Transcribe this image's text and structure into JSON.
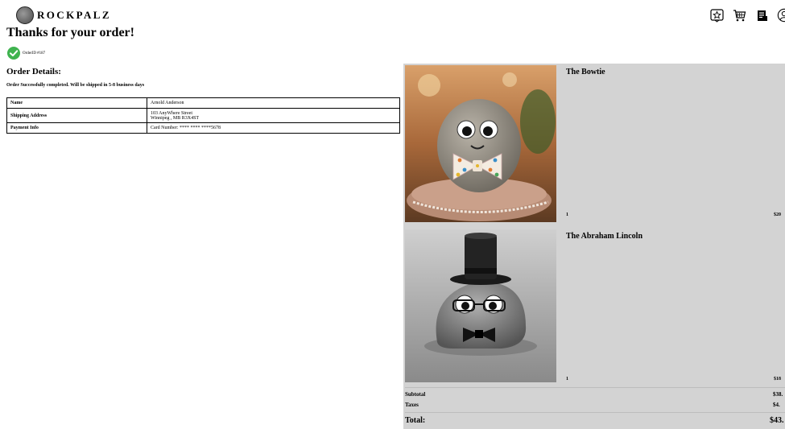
{
  "header": {
    "brand": "ROCKPALZ",
    "icons": [
      "favorites-icon",
      "cart-icon",
      "orders-icon",
      "account-icon"
    ]
  },
  "confirmation": {
    "title": "Thanks for your order!",
    "order_id": "OrderID #187"
  },
  "details": {
    "title": "Order Details:",
    "note": "Order Successfully completed. Will be shipped in 5-8 business days",
    "rows": [
      {
        "label": "Name",
        "value": "Arnold Anderson"
      },
      {
        "label": "Shipping Address",
        "value_line1": "103 AnyWhere Street",
        "value_line2": "Winnipeg , MB R3X4ST"
      },
      {
        "label": "Payment Info",
        "value": "Card Number: **** **** ****5678"
      }
    ]
  },
  "cart": {
    "items": [
      {
        "name": "The Bowtie",
        "qty": "1",
        "price": "$20"
      },
      {
        "name": "The Abraham Lincoln",
        "qty": "1",
        "price": "$18"
      }
    ],
    "subtotal_label": "Subtotal",
    "subtotal": "$38.",
    "taxes_label": "Taxes",
    "taxes": "$4.",
    "total_label": "Total:",
    "total": "$43."
  },
  "colors": {
    "cart_bg": "#d3d3d3",
    "check_green": "#3fb34f"
  }
}
